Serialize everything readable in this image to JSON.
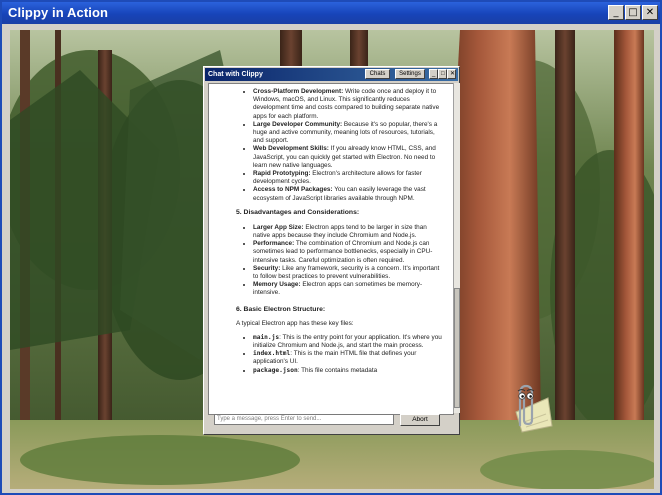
{
  "window": {
    "title": "Clippy in Action",
    "buttons": {
      "minimize": "_",
      "maximize": "□",
      "close": "✕"
    }
  },
  "chat": {
    "title": "Chat with Clippy",
    "buttons": {
      "chats": "Chats",
      "settings": "Settings",
      "minimize": "_",
      "maximize": "□",
      "close": "✕"
    },
    "input_placeholder": "Type a message, press Enter to send...",
    "abort_label": "Abort",
    "section4_items": [
      {
        "term": "Cross-Platform Development:",
        "text": "Write code once and deploy it to Windows, macOS, and Linux. This significantly reduces development time and costs compared to building separate native apps for each platform."
      },
      {
        "term": "Large Developer Community:",
        "text": "Because it's so popular, there's a huge and active community, meaning lots of resources, tutorials, and support."
      },
      {
        "term": "Web Development Skills:",
        "text": "If you already know HTML, CSS, and JavaScript, you can quickly get started with Electron. No need to learn new native languages."
      },
      {
        "term": "Rapid Prototyping:",
        "text": "Electron's architecture allows for faster development cycles."
      },
      {
        "term": "Access to NPM Packages:",
        "text": "You can easily leverage the vast ecosystem of JavaScript libraries available through NPM."
      }
    ],
    "section5_heading": "5. Disadvantages and Considerations:",
    "section5_items": [
      {
        "term": "Larger App Size:",
        "text": "Electron apps tend to be larger in size than native apps because they include Chromium and Node.js."
      },
      {
        "term": "Performance:",
        "text": "The combination of Chromium and Node.js can sometimes lead to performance bottlenecks, especially in CPU-intensive tasks. Careful optimization is often required."
      },
      {
        "term": "Security:",
        "text": "Like any framework, security is a concern. It's important to follow best practices to prevent vulnerabilities."
      },
      {
        "term": "Memory Usage:",
        "text": "Electron apps can sometimes be memory-intensive."
      }
    ],
    "section6_heading": "6. Basic Electron Structure:",
    "section6_intro": "A typical Electron app has these key files:",
    "section6_items": [
      {
        "code": "main.js",
        "text": ": This is the entry point for your application. It's where you initialize Chromium and Node.js, and start the main process."
      },
      {
        "code": "index.html",
        "text": ": This is the main HTML file that defines your application's UI."
      },
      {
        "code": "package.json",
        "text": ": This file contains metadata"
      }
    ]
  }
}
